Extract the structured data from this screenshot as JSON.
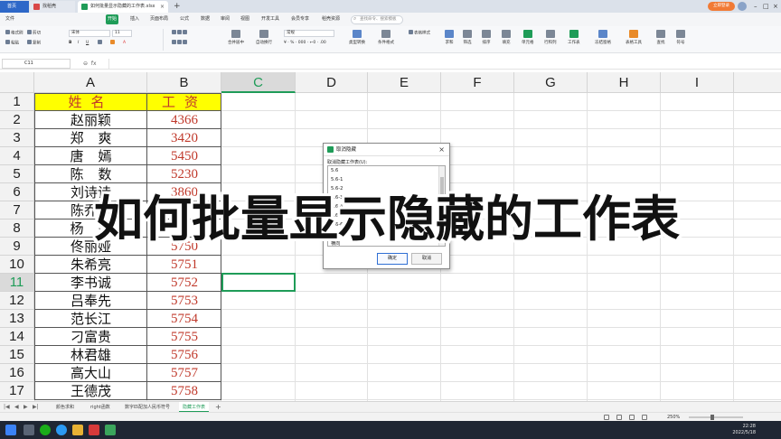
{
  "window_tabs": {
    "home": "首页",
    "find": "找稻壳",
    "document": "如何批量显示隐藏的工作表.xlsx"
  },
  "login": "立即登录",
  "menus": [
    "文件",
    "开始",
    "插入",
    "页面布局",
    "公式",
    "数据",
    "审阅",
    "视图",
    "开发工具",
    "会员专享",
    "稻壳资源"
  ],
  "active_menu": "开始",
  "search_placeholder": "查找命令、搜索模板",
  "ribbon": {
    "format_painter": "格式刷",
    "paste": "粘贴",
    "cut": "剪切",
    "copy": "复制",
    "font_name": "宋体",
    "font_size": "11",
    "merge_center": "合并居中",
    "auto_wrap": "自动换行",
    "number_format": "常规",
    "type_convert": "类型转换",
    "conditional_format": "条件格式",
    "table_style": "表格样式",
    "sum": "求和",
    "filter": "筛选",
    "sort": "排序",
    "fill": "填充",
    "cell": "单元格",
    "row_col": "行和列",
    "worksheet": "工作表",
    "freeze": "冻结窗格",
    "table_tools": "表格工具",
    "find": "查找",
    "symbol": "符号"
  },
  "name_box": "C11",
  "formula": "",
  "columns": [
    "A",
    "B",
    "C",
    "D",
    "E",
    "F",
    "G",
    "H",
    "I"
  ],
  "selected_column": "C",
  "selected_row": 11,
  "header_row": {
    "name": "姓名",
    "salary": "工资"
  },
  "rows": [
    {
      "num": 2,
      "name": "赵丽颖",
      "salary": "4366"
    },
    {
      "num": 3,
      "name": "郑爽",
      "salary": "3420"
    },
    {
      "num": 4,
      "name": "唐嫣",
      "salary": "5450"
    },
    {
      "num": 5,
      "name": "陈数",
      "salary": "5230"
    },
    {
      "num": 6,
      "name": "刘诗诗",
      "salary": "3860"
    },
    {
      "num": 7,
      "name": "陈乔恩",
      "salary": ""
    },
    {
      "num": 8,
      "name": "杨幂",
      "salary": ""
    },
    {
      "num": 9,
      "name": "佟丽娅",
      "salary": "5750"
    },
    {
      "num": 10,
      "name": "朱希亮",
      "salary": "5751"
    },
    {
      "num": 11,
      "name": "李书诚",
      "salary": "5752"
    },
    {
      "num": 12,
      "name": "吕奉先",
      "salary": "5753"
    },
    {
      "num": 13,
      "name": "范长江",
      "salary": "5754"
    },
    {
      "num": 14,
      "name": "刁富贵",
      "salary": "5755"
    },
    {
      "num": 15,
      "name": "林君雄",
      "salary": "5756"
    },
    {
      "num": 16,
      "name": "高大山",
      "salary": "5757"
    },
    {
      "num": 17,
      "name": "王德茂",
      "salary": "5758"
    }
  ],
  "dialog": {
    "title": "取消隐藏",
    "label": "取消隐藏工作表(U):",
    "items": [
      "5.6",
      "5.6-1",
      "5.6-2",
      "5.6-3",
      "5.6-4",
      "5.6-5",
      "5.6-6",
      "5.6-7",
      "横向"
    ],
    "ok": "确定",
    "cancel": "取消"
  },
  "caption": "如何批量显示隐藏的工作表",
  "sheets": [
    "颜色求和",
    "right函数",
    "数字匹配加人民币符号",
    "隐藏工作表"
  ],
  "active_sheet": "隐藏工作表",
  "zoom": "250%",
  "clock": {
    "time": "22:28",
    "date": "2022/5/18"
  },
  "colors": {
    "accent": "#1f9c58",
    "header_fill": "#ffff00",
    "value_red": "#c0392b",
    "taskbar": "#1f2633"
  }
}
